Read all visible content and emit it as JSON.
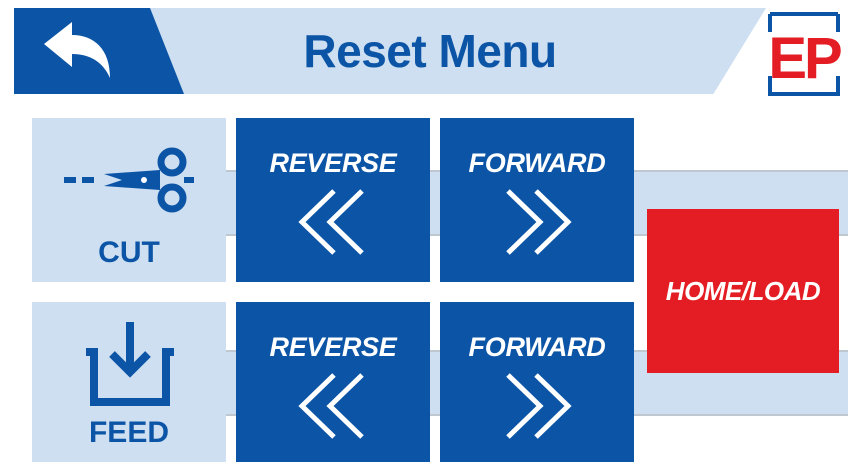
{
  "header": {
    "title": "Reset Menu",
    "back_icon": "back-arrow-icon",
    "logo_text": "EP"
  },
  "cut": {
    "label": "CUT",
    "icon": "scissors-icon",
    "reverse_label": "REVERSE",
    "forward_label": "FORWARD"
  },
  "feed": {
    "label": "FEED",
    "icon": "feed-down-arrow-icon",
    "reverse_label": "REVERSE",
    "forward_label": "FORWARD"
  },
  "home_load_label": "HOME/LOAD",
  "colors": {
    "primary_blue": "#0b54a6",
    "light_blue": "#cddff1",
    "red": "#e31d23"
  }
}
